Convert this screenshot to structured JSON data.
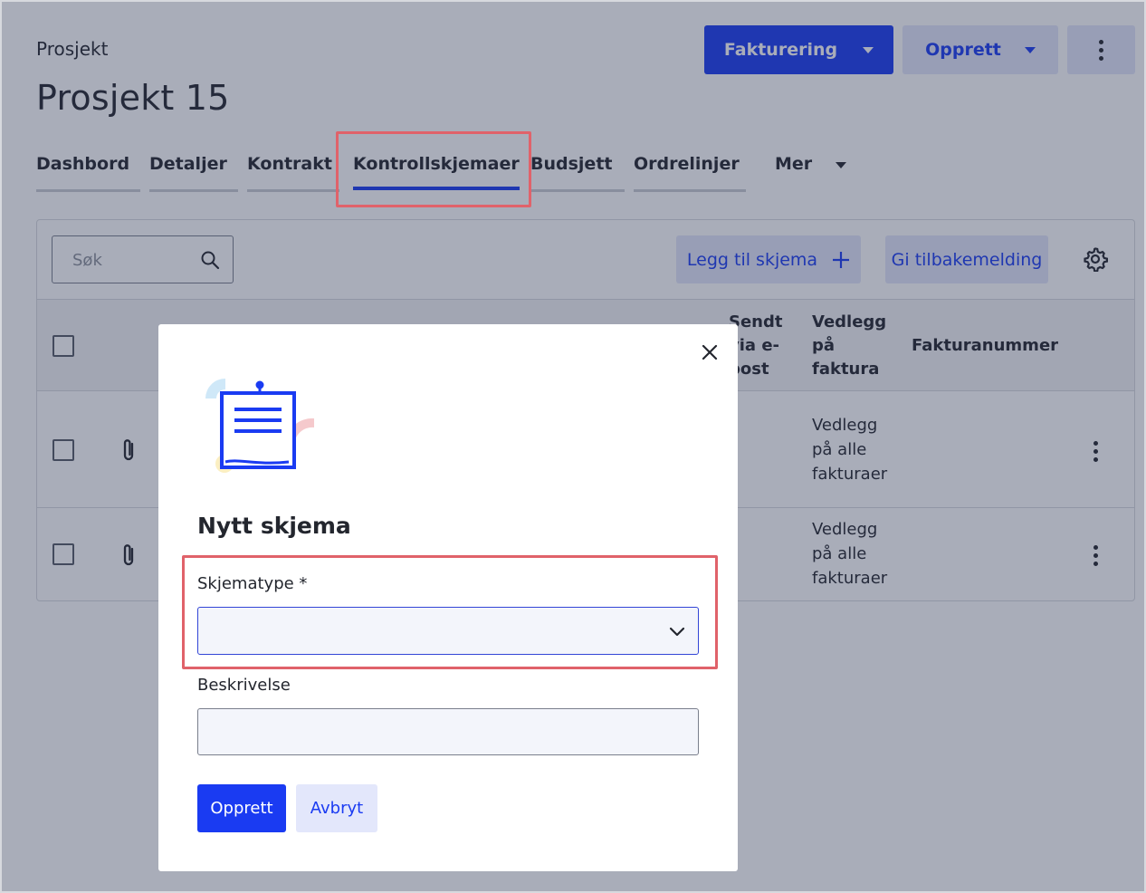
{
  "header": {
    "breadcrumb": "Prosjekt",
    "title": "Prosjekt 15",
    "billing_button": "Fakturering",
    "create_button": "Opprett"
  },
  "tabs": [
    {
      "label": "Dashbord"
    },
    {
      "label": "Detaljer"
    },
    {
      "label": "Kontrakt"
    },
    {
      "label": "Kontrollskjemaer",
      "active": true
    },
    {
      "label": "Budsjett"
    },
    {
      "label": "Ordrelinjer"
    },
    {
      "label": "Mer"
    }
  ],
  "toolbar": {
    "search_placeholder": "Søk",
    "add_form_button": "Legg til skjema",
    "feedback_button": "Gi tilbakemelding"
  },
  "table": {
    "columns": {
      "sent_email": "Sendt via e-post",
      "attach_invoice": "Vedlegg på faktura",
      "invoice_number": "Fakturanummer"
    },
    "rows": [
      {
        "attach_invoice": "Vedlegg på alle fakturaer"
      },
      {
        "attach_invoice": "Vedlegg på alle fakturaer"
      }
    ]
  },
  "modal": {
    "title": "Nytt skjema",
    "form_type_label": "Skjematype *",
    "form_type_value": "",
    "description_label": "Beskrivelse",
    "description_value": "",
    "submit_button": "Opprett",
    "cancel_button": "Avbryt"
  },
  "colors": {
    "accent": "#1a3bf2",
    "soft_button": "#e3e7fb",
    "highlight": "#e0626a"
  }
}
